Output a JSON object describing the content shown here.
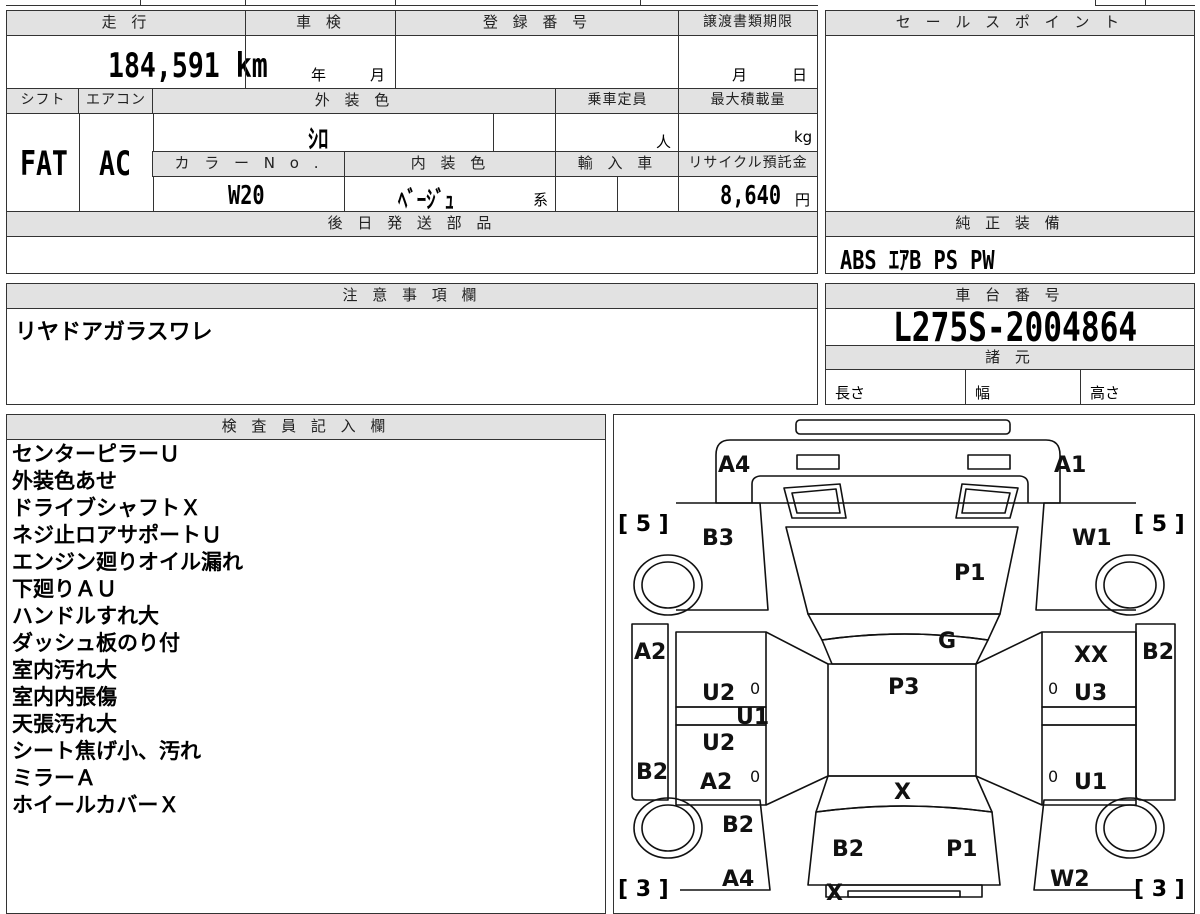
{
  "top_table": {
    "mileage_label": "走 行",
    "mileage_value": "184,591 km",
    "inspection_label": "車 検",
    "inspection_year": "年",
    "inspection_month": "月",
    "registration_label": "登 録 番 号",
    "transfer_label": "譲渡書類期限",
    "transfer_month": "月",
    "transfer_day": "日",
    "shift_label": "シフト",
    "shift_value": "FAT",
    "aircon_label": "エアコン",
    "aircon_value": "AC",
    "exterior_color_label": "外 装 色",
    "exterior_color_value": "ｼﾛ",
    "color_no_label": "カ ラ ー N o .",
    "color_no_value": "W20",
    "interior_color_label": "内 装 色",
    "interior_color_value": "ﾍﾞｰｼﾞｭ",
    "interior_color_suffix": "系",
    "capacity_label": "乗車定員",
    "capacity_unit": "人",
    "max_load_label": "最大積載量",
    "max_load_unit": "kg",
    "import_label": "輸 入 車",
    "recycle_label": "リサイクル預託金",
    "recycle_value": "8,640",
    "recycle_unit": "円",
    "later_parts_label": "後 日 発 送 部 品",
    "later_parts_value": ""
  },
  "sales_point": {
    "label": "セ ー ル ス ポ イ ン ト",
    "value": ""
  },
  "equipment": {
    "label": "純 正 装 備",
    "value": "ABS ｴｱB PS PW"
  },
  "caution": {
    "label": "注 意 事 項 欄",
    "value": "リヤドアガラスワレ"
  },
  "chassis": {
    "label": "車 台 番 号",
    "value": "L275S-2004864",
    "spec_label": "諸 元",
    "length_label": "長さ",
    "width_label": "幅",
    "height_label": "高さ"
  },
  "inspector": {
    "label": "検 査 員 記 入 欄",
    "notes": [
      "センターピラーＵ",
      "外装色あせ",
      "ドライブシャフトＸ",
      "ネジ止ロアサポートＵ",
      "エンジン廻りオイル漏れ",
      "下廻りＡＵ",
      "ハンドルすれ大",
      "ダッシュ板のり付",
      "室内汚れ大",
      "室内内張傷",
      "天張汚れ大",
      "シート焦げ小、汚れ",
      "ミラーＡ",
      "ホイールカバーＸ"
    ]
  },
  "diagram": {
    "bracket_top_left": "[ 5 ]",
    "bracket_top_right": "[ 5 ]",
    "bracket_bottom_left": "[ 3 ]",
    "bracket_bottom_right": "[ 3 ]",
    "marks": {
      "a4_top": "A4",
      "a1_top": "A1",
      "b3": "B3",
      "w1": "W1",
      "p1_top": "P1",
      "g": "G",
      "a2_left": "A2",
      "xx": "XX",
      "b2_right": "B2",
      "p3": "P3",
      "u2_a": "U2",
      "zero_a": "0",
      "zero_b": "0",
      "u3": "U3",
      "u1_center": "U1",
      "u2_b": "U2",
      "b2_left": "B2",
      "a2_mid": "A2",
      "zero_c": "0",
      "zero_d": "0",
      "u1_right": "U1",
      "x_center": "X",
      "b2_lower": "B2",
      "b2_bottom": "B2",
      "p1_bottom": "P1",
      "a4_bottom": "A4",
      "w2": "W2",
      "x_bottom": "X"
    }
  }
}
